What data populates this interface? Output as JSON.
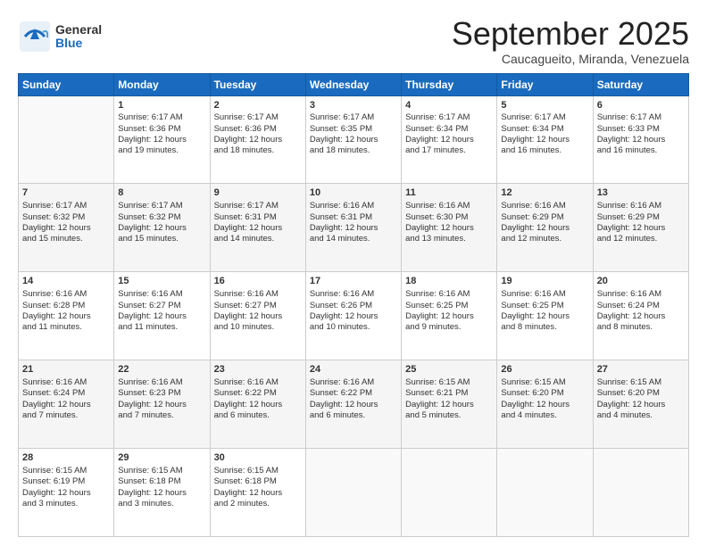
{
  "logo": {
    "general": "General",
    "blue": "Blue"
  },
  "header": {
    "month": "September 2025",
    "location": "Caucagueito, Miranda, Venezuela"
  },
  "weekdays": [
    "Sunday",
    "Monday",
    "Tuesday",
    "Wednesday",
    "Thursday",
    "Friday",
    "Saturday"
  ],
  "weeks": [
    [
      {
        "day": "",
        "info": ""
      },
      {
        "day": "1",
        "info": "Sunrise: 6:17 AM\nSunset: 6:36 PM\nDaylight: 12 hours\nand 19 minutes."
      },
      {
        "day": "2",
        "info": "Sunrise: 6:17 AM\nSunset: 6:36 PM\nDaylight: 12 hours\nand 18 minutes."
      },
      {
        "day": "3",
        "info": "Sunrise: 6:17 AM\nSunset: 6:35 PM\nDaylight: 12 hours\nand 18 minutes."
      },
      {
        "day": "4",
        "info": "Sunrise: 6:17 AM\nSunset: 6:34 PM\nDaylight: 12 hours\nand 17 minutes."
      },
      {
        "day": "5",
        "info": "Sunrise: 6:17 AM\nSunset: 6:34 PM\nDaylight: 12 hours\nand 16 minutes."
      },
      {
        "day": "6",
        "info": "Sunrise: 6:17 AM\nSunset: 6:33 PM\nDaylight: 12 hours\nand 16 minutes."
      }
    ],
    [
      {
        "day": "7",
        "info": "Sunrise: 6:17 AM\nSunset: 6:32 PM\nDaylight: 12 hours\nand 15 minutes."
      },
      {
        "day": "8",
        "info": "Sunrise: 6:17 AM\nSunset: 6:32 PM\nDaylight: 12 hours\nand 15 minutes."
      },
      {
        "day": "9",
        "info": "Sunrise: 6:17 AM\nSunset: 6:31 PM\nDaylight: 12 hours\nand 14 minutes."
      },
      {
        "day": "10",
        "info": "Sunrise: 6:16 AM\nSunset: 6:31 PM\nDaylight: 12 hours\nand 14 minutes."
      },
      {
        "day": "11",
        "info": "Sunrise: 6:16 AM\nSunset: 6:30 PM\nDaylight: 12 hours\nand 13 minutes."
      },
      {
        "day": "12",
        "info": "Sunrise: 6:16 AM\nSunset: 6:29 PM\nDaylight: 12 hours\nand 12 minutes."
      },
      {
        "day": "13",
        "info": "Sunrise: 6:16 AM\nSunset: 6:29 PM\nDaylight: 12 hours\nand 12 minutes."
      }
    ],
    [
      {
        "day": "14",
        "info": "Sunrise: 6:16 AM\nSunset: 6:28 PM\nDaylight: 12 hours\nand 11 minutes."
      },
      {
        "day": "15",
        "info": "Sunrise: 6:16 AM\nSunset: 6:27 PM\nDaylight: 12 hours\nand 11 minutes."
      },
      {
        "day": "16",
        "info": "Sunrise: 6:16 AM\nSunset: 6:27 PM\nDaylight: 12 hours\nand 10 minutes."
      },
      {
        "day": "17",
        "info": "Sunrise: 6:16 AM\nSunset: 6:26 PM\nDaylight: 12 hours\nand 10 minutes."
      },
      {
        "day": "18",
        "info": "Sunrise: 6:16 AM\nSunset: 6:25 PM\nDaylight: 12 hours\nand 9 minutes."
      },
      {
        "day": "19",
        "info": "Sunrise: 6:16 AM\nSunset: 6:25 PM\nDaylight: 12 hours\nand 8 minutes."
      },
      {
        "day": "20",
        "info": "Sunrise: 6:16 AM\nSunset: 6:24 PM\nDaylight: 12 hours\nand 8 minutes."
      }
    ],
    [
      {
        "day": "21",
        "info": "Sunrise: 6:16 AM\nSunset: 6:24 PM\nDaylight: 12 hours\nand 7 minutes."
      },
      {
        "day": "22",
        "info": "Sunrise: 6:16 AM\nSunset: 6:23 PM\nDaylight: 12 hours\nand 7 minutes."
      },
      {
        "day": "23",
        "info": "Sunrise: 6:16 AM\nSunset: 6:22 PM\nDaylight: 12 hours\nand 6 minutes."
      },
      {
        "day": "24",
        "info": "Sunrise: 6:16 AM\nSunset: 6:22 PM\nDaylight: 12 hours\nand 6 minutes."
      },
      {
        "day": "25",
        "info": "Sunrise: 6:15 AM\nSunset: 6:21 PM\nDaylight: 12 hours\nand 5 minutes."
      },
      {
        "day": "26",
        "info": "Sunrise: 6:15 AM\nSunset: 6:20 PM\nDaylight: 12 hours\nand 4 minutes."
      },
      {
        "day": "27",
        "info": "Sunrise: 6:15 AM\nSunset: 6:20 PM\nDaylight: 12 hours\nand 4 minutes."
      }
    ],
    [
      {
        "day": "28",
        "info": "Sunrise: 6:15 AM\nSunset: 6:19 PM\nDaylight: 12 hours\nand 3 minutes."
      },
      {
        "day": "29",
        "info": "Sunrise: 6:15 AM\nSunset: 6:18 PM\nDaylight: 12 hours\nand 3 minutes."
      },
      {
        "day": "30",
        "info": "Sunrise: 6:15 AM\nSunset: 6:18 PM\nDaylight: 12 hours\nand 2 minutes."
      },
      {
        "day": "",
        "info": ""
      },
      {
        "day": "",
        "info": ""
      },
      {
        "day": "",
        "info": ""
      },
      {
        "day": "",
        "info": ""
      }
    ]
  ]
}
